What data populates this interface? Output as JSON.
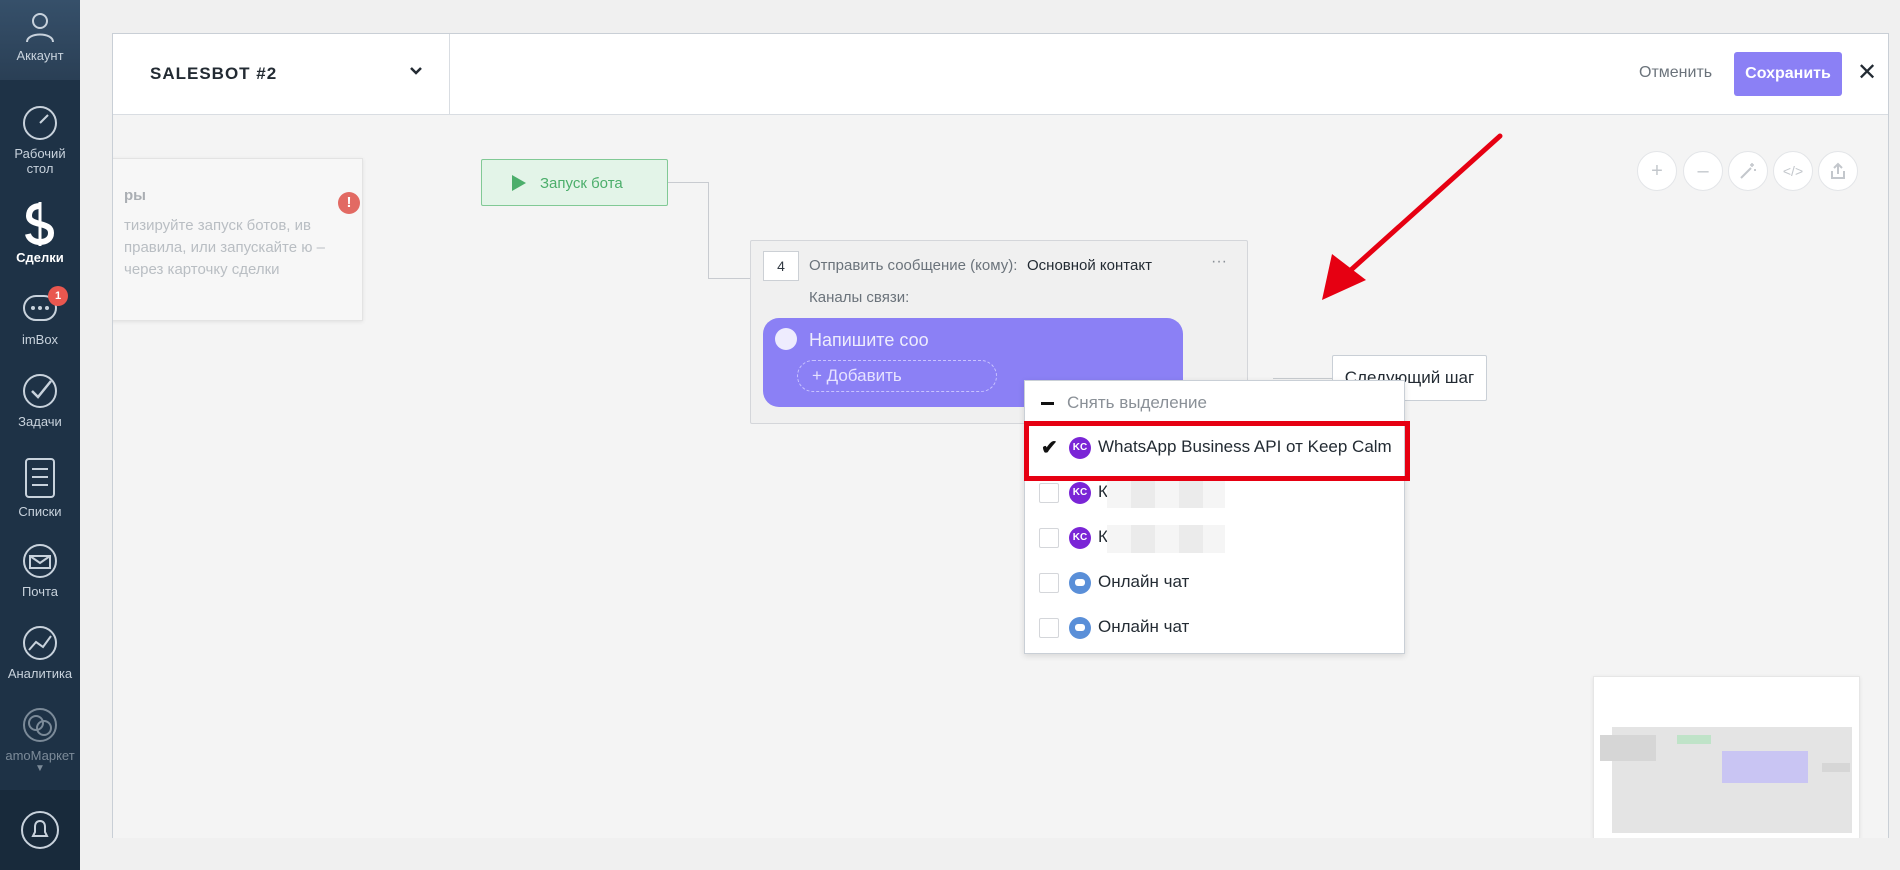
{
  "sidebar": {
    "items": [
      {
        "id": "account",
        "label": "Аккаунт",
        "icon": "user-icon"
      },
      {
        "id": "dashboard",
        "label": "Рабочий стол",
        "icon": "speedometer-icon"
      },
      {
        "id": "deals",
        "label": "Сделки",
        "icon": "dollar-icon",
        "active": true
      },
      {
        "id": "imbox",
        "label": "imBox",
        "icon": "chat-icon",
        "badge": "1"
      },
      {
        "id": "tasks",
        "label": "Задачи",
        "icon": "check-icon"
      },
      {
        "id": "lists",
        "label": "Списки",
        "icon": "list-icon"
      },
      {
        "id": "mail",
        "label": "Почта",
        "icon": "mail-icon"
      },
      {
        "id": "analytics",
        "label": "Аналитика",
        "icon": "analytics-icon"
      },
      {
        "id": "market",
        "label": "amoМаркет",
        "icon": "market-icon"
      }
    ]
  },
  "header": {
    "bot_name": "SALESBOT #2",
    "cancel_label": "Отменить",
    "save_label": "Сохранить",
    "close_label": "✕"
  },
  "info_card": {
    "title": "ры",
    "text": "тизируйте запуск ботов, ив правила, или запускайте ю – через карточку сделки"
  },
  "start_node": {
    "label": "Запуск бота"
  },
  "step": {
    "number": "4",
    "send_label": "Отправить сообщение (кому):",
    "send_value": "Основной контакт",
    "menu": "···",
    "channels_label": "Каналы связи:",
    "message_placeholder": "Напишите соо",
    "add_label": "+ Добавить"
  },
  "dropdown": {
    "deselect_label": "Снять выделение",
    "options": [
      {
        "label": "WhatsApp Business API от Keep Calm",
        "logo": "KC",
        "checked": true
      },
      {
        "label": "К",
        "logo": "KC",
        "checked": false
      },
      {
        "label": "К",
        "logo": "KC",
        "checked": false
      },
      {
        "label": "Онлайн чат",
        "logo": "chat",
        "checked": false
      },
      {
        "label": "Онлайн чат",
        "logo": "chat",
        "checked": false
      }
    ]
  },
  "next_step_label": "Следующий шаг",
  "colors": {
    "accent": "#8b80f5",
    "start_green": "#4cae6b",
    "highlight": "#e60012",
    "sidebar": "#1e3246"
  }
}
